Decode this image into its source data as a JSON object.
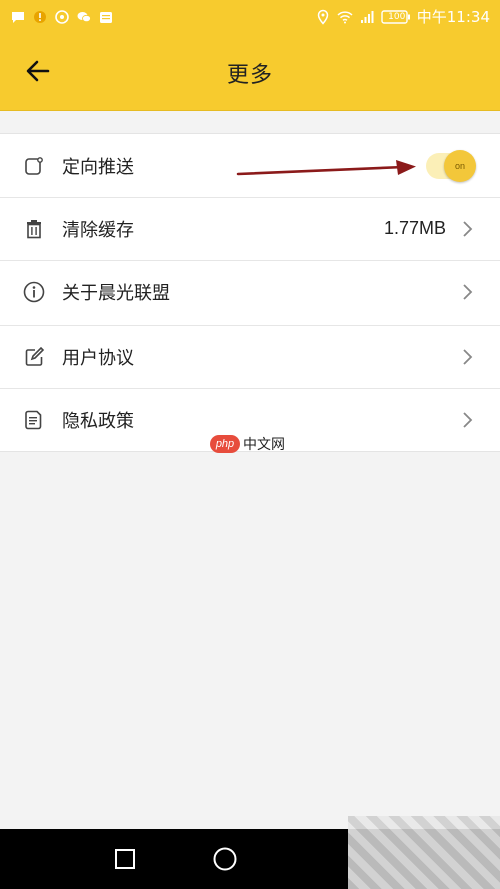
{
  "status_bar": {
    "time_text": "中午11:34",
    "battery_text": "100"
  },
  "header": {
    "title": "更多"
  },
  "list": {
    "items": [
      {
        "label": "定向推送",
        "icon": "bell-square-icon",
        "toggle_text": "on",
        "toggle_on": true
      },
      {
        "label": "清除缓存",
        "icon": "trash-icon",
        "value": "1.77MB"
      },
      {
        "label": "关于晨光联盟",
        "icon": "info-icon"
      },
      {
        "label": "用户协议",
        "icon": "edit-icon"
      },
      {
        "label": "隐私政策",
        "icon": "document-icon"
      }
    ]
  },
  "watermark": {
    "badge": "php",
    "text": "中文网"
  },
  "colors": {
    "accent": "#f7cb2e",
    "annotation_arrow": "#8b1a1a",
    "background": "#f3f3f3"
  }
}
